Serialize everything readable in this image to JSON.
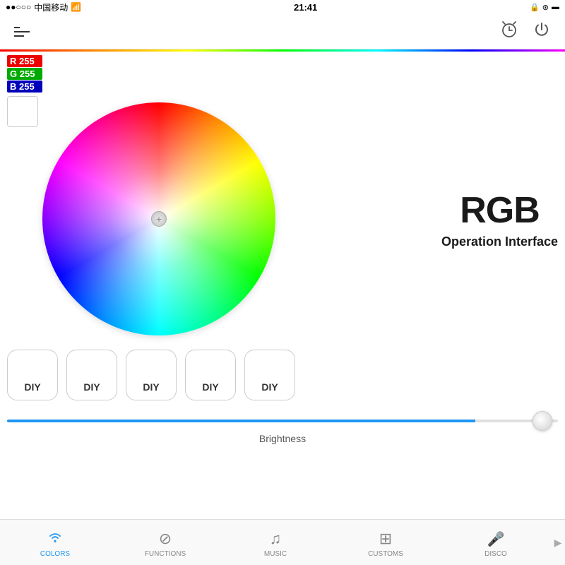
{
  "statusBar": {
    "carrier": "中国移动",
    "time": "21:41",
    "icons": [
      "📶",
      "🔒",
      "☁",
      "🔵",
      "🔋"
    ]
  },
  "navBar": {
    "menuLabel": "Menu",
    "alarmLabel": "Alarm",
    "powerLabel": "Power"
  },
  "rgbDisplay": {
    "rLabel": "R",
    "rValue": "255",
    "gLabel": "G",
    "gValue": "255",
    "bLabel": "B",
    "bValue": "255"
  },
  "wheelSection": {
    "title": "RGB",
    "subtitle": "Operation Interface"
  },
  "diyButtons": [
    {
      "label": "DIY"
    },
    {
      "label": "DIY"
    },
    {
      "label": "DIY"
    },
    {
      "label": "DIY"
    },
    {
      "label": "DIY"
    }
  ],
  "brightness": {
    "label": "Brightness",
    "value": 85
  },
  "tabBar": {
    "tabs": [
      {
        "id": "colors",
        "label": "COLORS",
        "icon": "⌂",
        "active": true
      },
      {
        "id": "functions",
        "label": "FUNCTIONS",
        "icon": "⊘",
        "active": false
      },
      {
        "id": "music",
        "label": "MUSIC",
        "icon": "♫",
        "active": false
      },
      {
        "id": "customs",
        "label": "CUSTOMS",
        "icon": "⊞",
        "active": false
      },
      {
        "id": "disco",
        "label": "DISCO",
        "icon": "🎤",
        "active": false
      }
    ]
  }
}
